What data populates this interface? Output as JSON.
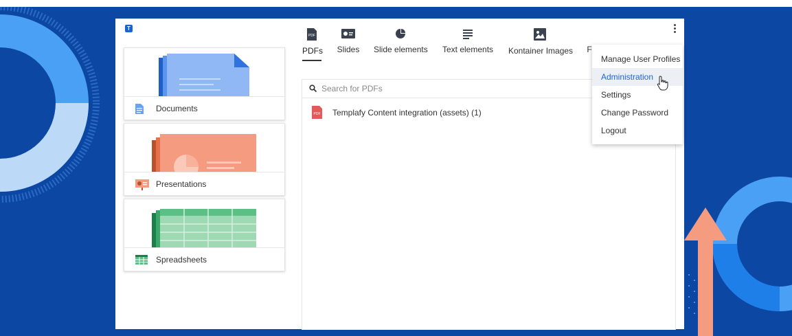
{
  "app": {
    "logo_label": "T"
  },
  "cards": [
    {
      "label": "Documents",
      "icon": "document-icon",
      "color": "#8fb8f5"
    },
    {
      "label": "Presentations",
      "icon": "presentation-icon",
      "color": "#f59b80"
    },
    {
      "label": "Spreadsheets",
      "icon": "spreadsheet-icon",
      "color": "#9fd9b4"
    }
  ],
  "tabs": [
    {
      "label": "PDFs",
      "icon": "pdf-icon",
      "active": true
    },
    {
      "label": "Slides",
      "icon": "slides-icon"
    },
    {
      "label": "Slide elements",
      "icon": "pie-chart-icon"
    },
    {
      "label": "Text elements",
      "icon": "text-lines-icon"
    },
    {
      "label": "Kontainer Images",
      "icon": "image-icon"
    },
    {
      "label": "F",
      "icon": "truncated-tab"
    }
  ],
  "search": {
    "placeholder": "Search for PDFs"
  },
  "results": [
    {
      "label": "Templafy Content integration (assets) (1)",
      "icon": "pdf-file-icon"
    }
  ],
  "menu": {
    "items": [
      {
        "label": "Manage User Profiles"
      },
      {
        "label": "Administration",
        "hovered": true
      },
      {
        "label": "Settings"
      },
      {
        "label": "Change Password"
      },
      {
        "label": "Logout"
      }
    ]
  },
  "colors": {
    "background": "#0b47a3",
    "accent": "#1a66d6",
    "orange": "#f59b80"
  }
}
